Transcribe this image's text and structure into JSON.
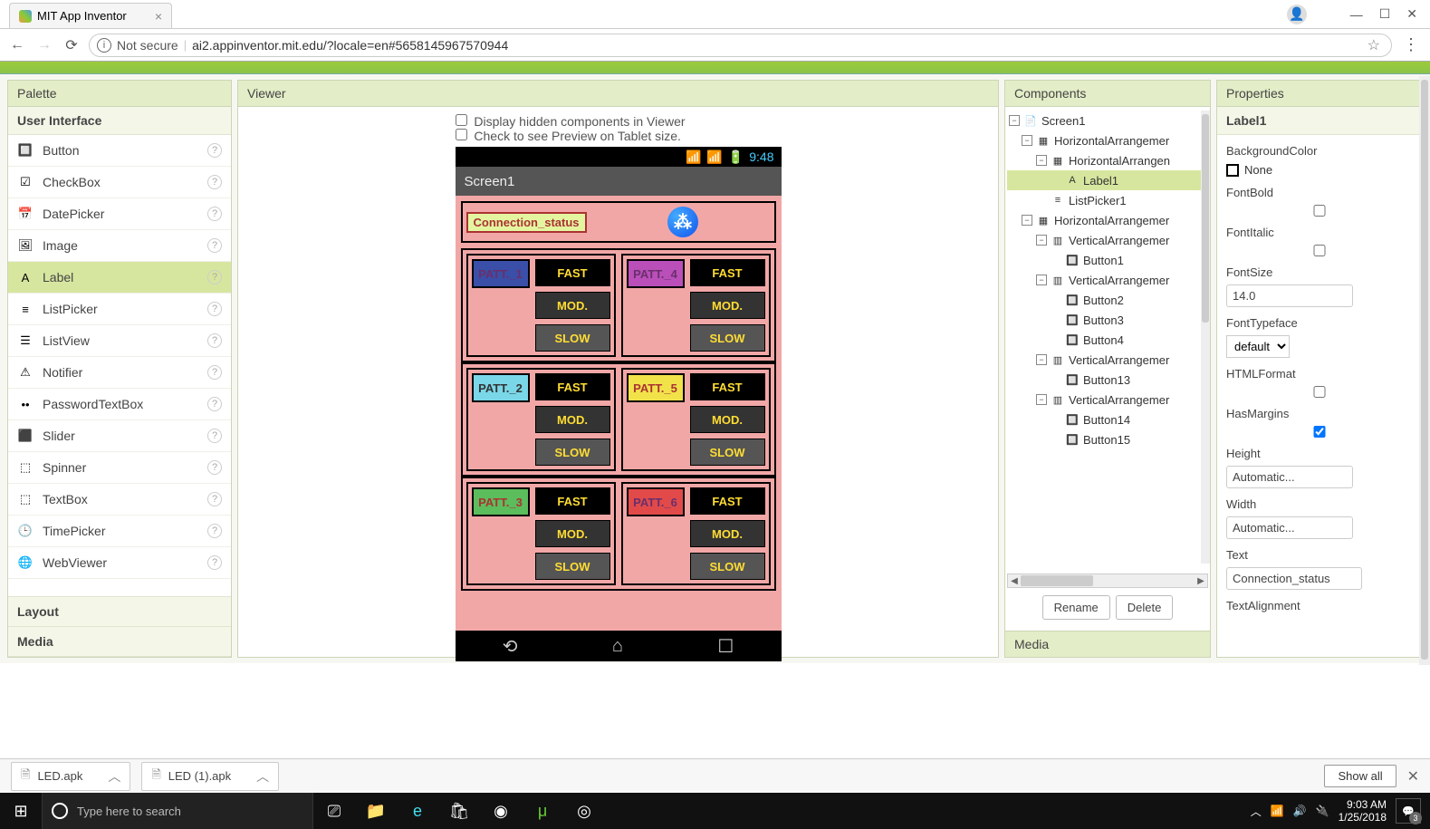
{
  "browser": {
    "tab_title": "MIT App Inventor",
    "security_label": "Not secure",
    "url": "ai2.appinventor.mit.edu/?locale=en#5658145967570944",
    "win_min": "—",
    "win_max": "☐",
    "win_close": "✕"
  },
  "palette": {
    "header": "Palette",
    "category": "User Interface",
    "items": [
      {
        "icon": "🔲",
        "label": "Button"
      },
      {
        "icon": "☑",
        "label": "CheckBox"
      },
      {
        "icon": "📅",
        "label": "DatePicker"
      },
      {
        "icon": "🖼",
        "label": "Image"
      },
      {
        "icon": "A",
        "label": "Label",
        "selected": true
      },
      {
        "icon": "≡",
        "label": "ListPicker"
      },
      {
        "icon": "☰",
        "label": "ListView"
      },
      {
        "icon": "⚠",
        "label": "Notifier"
      },
      {
        "icon": "••",
        "label": "PasswordTextBox"
      },
      {
        "icon": "⬛",
        "label": "Slider"
      },
      {
        "icon": "⬚",
        "label": "Spinner"
      },
      {
        "icon": "⬚",
        "label": "TextBox"
      },
      {
        "icon": "🕒",
        "label": "TimePicker"
      },
      {
        "icon": "🌐",
        "label": "WebViewer"
      }
    ],
    "layout_header": "Layout",
    "media_header": "Media"
  },
  "viewer": {
    "header": "Viewer",
    "check_hidden": "Display hidden components in Viewer",
    "check_tablet": "Check to see Preview on Tablet size.",
    "phone_time": "9:48",
    "screen_title": "Screen1",
    "conn_status": "Connection_status",
    "patterns": [
      [
        {
          "name": "PATT._1",
          "color": "#3a4fa8",
          "text": "#6b2f6b"
        },
        {
          "name": "PATT._4",
          "color": "#ba4fba",
          "text": "#6b2f6b"
        }
      ],
      [
        {
          "name": "PATT._2",
          "color": "#7ad7e8",
          "text": "#333"
        },
        {
          "name": "PATT._5",
          "color": "#f2e24a",
          "text": "#a33"
        }
      ],
      [
        {
          "name": "PATT._3",
          "color": "#5cbd5c",
          "text": "#a33"
        },
        {
          "name": "PATT._6",
          "color": "#e24a4a",
          "text": "#6b2f6b"
        }
      ]
    ],
    "speeds": [
      "FAST",
      "MOD.",
      "SLOW"
    ]
  },
  "components": {
    "header": "Components",
    "tree": [
      {
        "level": 0,
        "icon": "📄",
        "label": "Screen1",
        "toggle": "−"
      },
      {
        "level": 1,
        "icon": "▦",
        "label": "HorizontalArrangemer",
        "toggle": "−"
      },
      {
        "level": 2,
        "icon": "▦",
        "label": "HorizontalArrangen",
        "toggle": "−"
      },
      {
        "level": 3,
        "icon": "A",
        "label": "Label1",
        "selected": true
      },
      {
        "level": 2,
        "icon": "≡",
        "label": "ListPicker1"
      },
      {
        "level": 1,
        "icon": "▦",
        "label": "HorizontalArrangemer",
        "toggle": "−"
      },
      {
        "level": 2,
        "icon": "▥",
        "label": "VerticalArrangemer",
        "toggle": "−"
      },
      {
        "level": 3,
        "icon": "🔲",
        "label": "Button1"
      },
      {
        "level": 2,
        "icon": "▥",
        "label": "VerticalArrangemer",
        "toggle": "−"
      },
      {
        "level": 3,
        "icon": "🔲",
        "label": "Button2"
      },
      {
        "level": 3,
        "icon": "🔲",
        "label": "Button3"
      },
      {
        "level": 3,
        "icon": "🔲",
        "label": "Button4"
      },
      {
        "level": 2,
        "icon": "▥",
        "label": "VerticalArrangemer",
        "toggle": "−"
      },
      {
        "level": 3,
        "icon": "🔲",
        "label": "Button13"
      },
      {
        "level": 2,
        "icon": "▥",
        "label": "VerticalArrangemer",
        "toggle": "−"
      },
      {
        "level": 3,
        "icon": "🔲",
        "label": "Button14"
      },
      {
        "level": 3,
        "icon": "🔲",
        "label": "Button15"
      }
    ],
    "rename": "Rename",
    "delete": "Delete",
    "media_header": "Media"
  },
  "properties": {
    "header": "Properties",
    "component": "Label1",
    "fields": {
      "BackgroundColor_label": "BackgroundColor",
      "BackgroundColor_value": "None",
      "FontBold_label": "FontBold",
      "FontBold_value": false,
      "FontItalic_label": "FontItalic",
      "FontItalic_value": false,
      "FontSize_label": "FontSize",
      "FontSize_value": "14.0",
      "FontTypeface_label": "FontTypeface",
      "FontTypeface_value": "default",
      "HTMLFormat_label": "HTMLFormat",
      "HTMLFormat_value": false,
      "HasMargins_label": "HasMargins",
      "HasMargins_value": true,
      "Height_label": "Height",
      "Height_value": "Automatic...",
      "Width_label": "Width",
      "Width_value": "Automatic...",
      "Text_label": "Text",
      "Text_value": "Connection_status",
      "TextAlignment_label": "TextAlignment"
    }
  },
  "downloads": {
    "file1": "LED.apk",
    "file2": "LED (1).apk",
    "showall": "Show all"
  },
  "taskbar": {
    "search_placeholder": "Type here to search",
    "time": "9:03 AM",
    "date": "1/25/2018",
    "notif_count": "3"
  }
}
